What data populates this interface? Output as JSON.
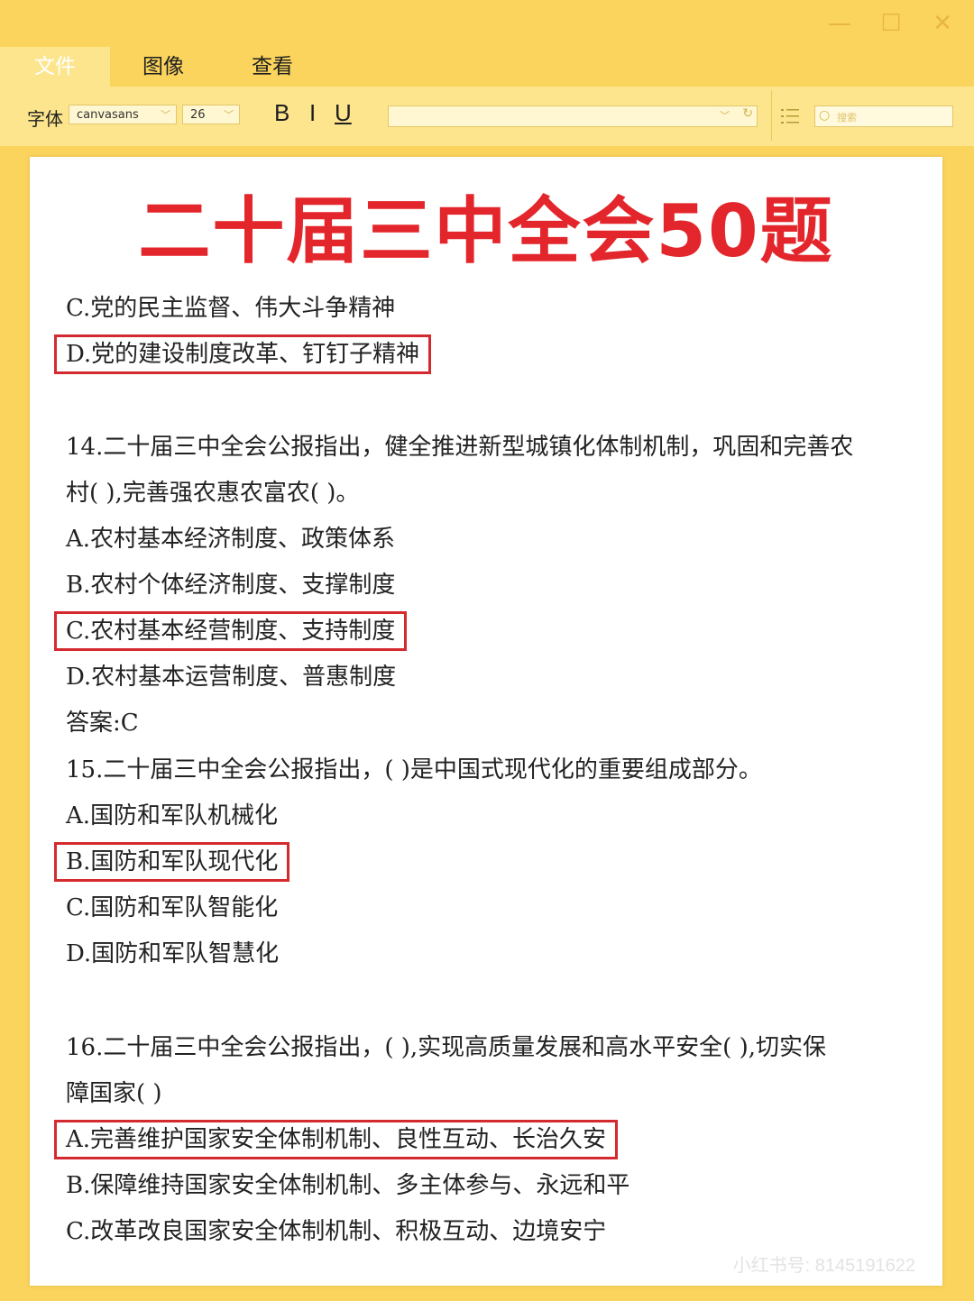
{
  "window": {
    "min_glyph": "—",
    "max_glyph": "☐",
    "close_glyph": "✕"
  },
  "menu": {
    "items": [
      "文件",
      "图像",
      "查看"
    ]
  },
  "toolbar": {
    "font_label": "字体",
    "font_name": "canvasans",
    "font_size": "26",
    "bold": "B",
    "italic": "I",
    "underline": "U",
    "search_placeholder": "搜索"
  },
  "document": {
    "title": "二十届三中全会50题",
    "lines": [
      "C.党的民主监督、伟大斗争精神",
      "D.党的建设制度改革、钉钉子精神",
      "14.二十届三中全会公报指出，健全推进新型城镇化体制机制，巩固和完善农",
      "村(    ),完善强农惠农富农(    )。",
      "A.农村基本经济制度、政策体系",
      "B.农村个体经济制度、支撑制度",
      "C.农村基本经营制度、支持制度",
      "D.农村基本运营制度、普惠制度",
      "答案:C",
      "15.二十届三中全会公报指出，(    )是中国式现代化的重要组成部分。",
      "A.国防和军队机械化",
      "B.国防和军队现代化",
      "C.国防和军队智能化",
      "D.国防和军队智慧化",
      "16.二十届三中全会公报指出，(    ),实现高质量发展和高水平安全(    ),切实保",
      "障国家(    )",
      "A.完善维护国家安全体制机制、良性互动、长治久安",
      "B.保障维持国家安全体制机制、多主体参与、永远和平",
      "C.改革改良国家安全体制机制、积极互动、边境安宁"
    ]
  },
  "watermark": "小红书号: 8145191622",
  "colors": {
    "accent": "#fbd45e",
    "title_red": "#e3262b",
    "box_red": "#d42a2f"
  }
}
